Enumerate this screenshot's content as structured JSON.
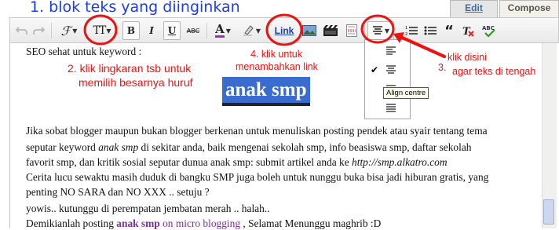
{
  "annotations": {
    "title": "1. blok teks yang diinginkan",
    "step2_line1": "2. klik lingkaran tsb untuk",
    "step2_line2": "memilih besarnya huruf",
    "step4_line1": "4. klik untuk",
    "step4_line2": "menambahkan link",
    "step3_line1": "klik disini",
    "step3_num": "3.",
    "step3_line2": "agar teks di tengah",
    "accent_color": "#ee1111",
    "title_color": "#1a3df0"
  },
  "tabs": {
    "edit_html": "Edit HTML",
    "compose": "Compose"
  },
  "toolbar": {
    "font_size_label": "TT",
    "bold": "B",
    "italic": "I",
    "underline": "U",
    "strike": "ABC",
    "text_color": "A",
    "link": "Link"
  },
  "align_menu": {
    "tooltip": "Align centre"
  },
  "editor": {
    "line1": "SEO sehat untuk keyword :",
    "big_phrase": "anak smp",
    "p1_line1": "Jika sobat blogger maupun bukan blogger berkenan untuk menuliskan posting pendek atau syair tentang tema",
    "p1_line2_a": "seputar keyword ",
    "p1_line2_em": "anak smp",
    "p1_line2_b": " di sekitar anda, baik mengenai sekolah smp, info beasiswa smp, daftar sekolah",
    "p1_line3_a": "favorit smp, dan  kritik sosial seputar dunua anak smp: submit artikel anda ke ",
    "p1_line3_url": "http://smp.alkatro.com",
    "p2_line1": "Cerita lucu sewaktu masih duduk di bangku SMP juga boleh untuk nunggu buka bisa jadi hiburan gratis, yang",
    "p2_line2": "penting NO SARA dan NO XXX .. setuju ?",
    "p3_line1": "yowis.. kutunggu di perempatan jembatan merah .. halah..",
    "p4_a": "Demikianlah posting ",
    "p4_link1": "anak smp",
    "p4_link2": " on micro blogging",
    "p4_b": " , Selamat Menunggu maghrib :D"
  }
}
